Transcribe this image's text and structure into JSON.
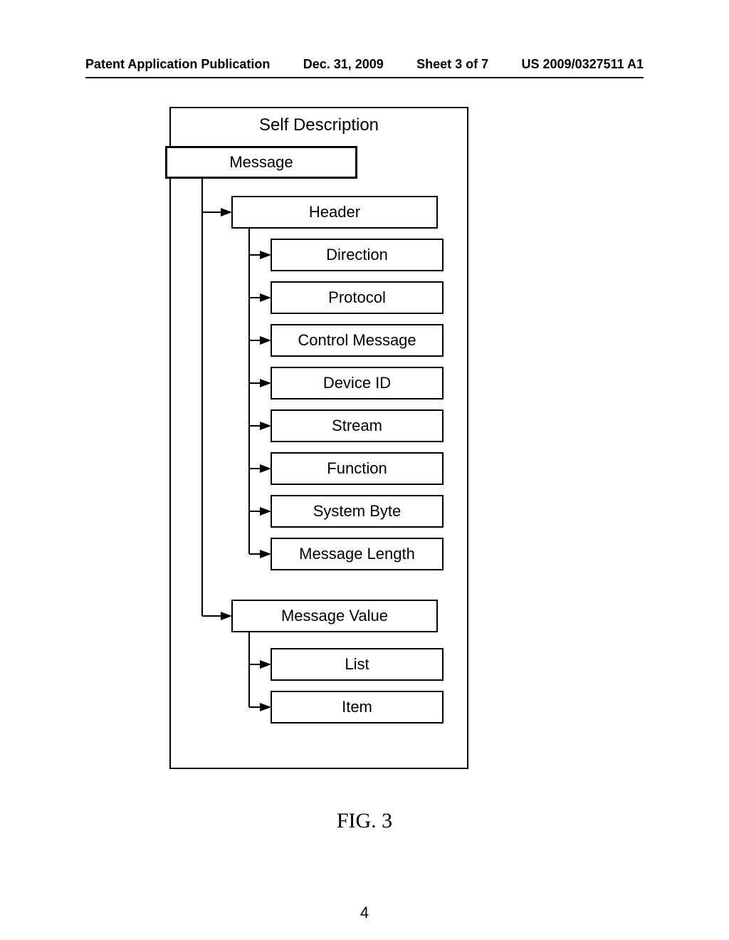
{
  "header": {
    "left": "Patent Application Publication",
    "date": "Dec. 31, 2009",
    "sheet": "Sheet 3 of 7",
    "pubno": "US 2009/0327511 A1"
  },
  "diagram": {
    "title": "Self Description",
    "figure_label": "FIG. 3",
    "root": "Message",
    "nodes": {
      "message": "Message",
      "header": "Header",
      "direction": "Direction",
      "protocol": "Protocol",
      "control": "Control Message",
      "deviceid": "Device ID",
      "stream": "Stream",
      "function": "Function",
      "sysbyte": "System Byte",
      "msglen": "Message Length",
      "msgval": "Message Value",
      "list": "List",
      "item": "Item"
    }
  },
  "page_number": "4"
}
